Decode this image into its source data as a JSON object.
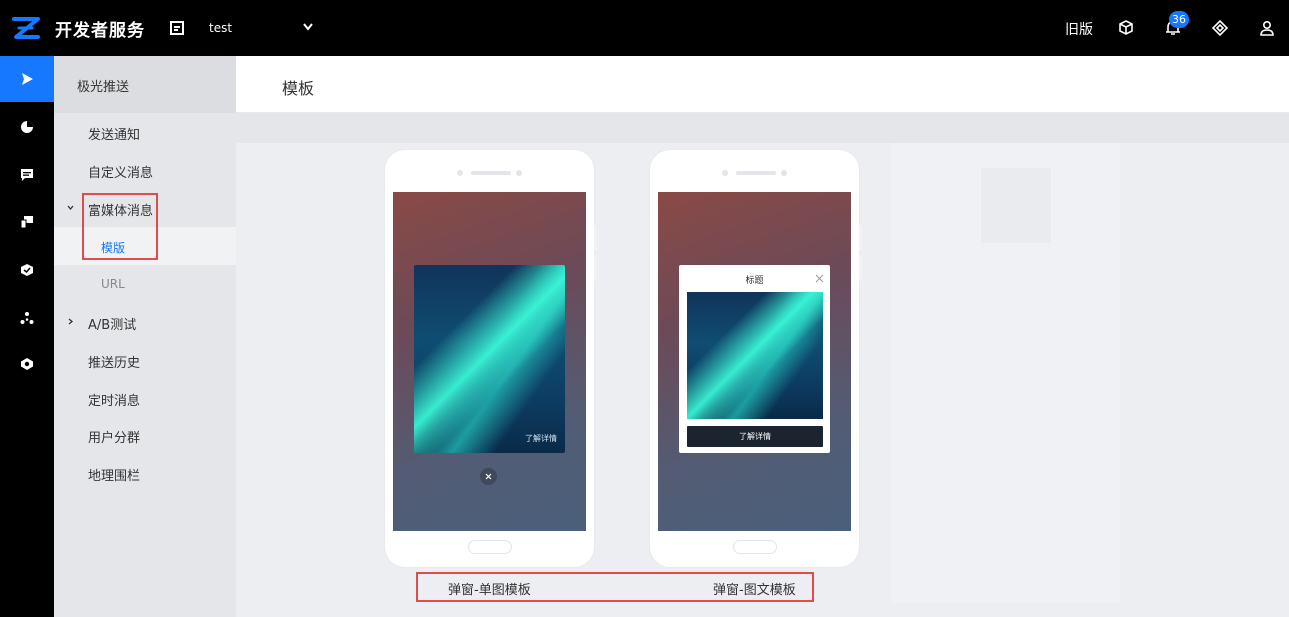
{
  "header": {
    "brand": "开发者服务",
    "app_name": "test",
    "old_version": "旧版",
    "notification_count": "36",
    "accent_color": "#1677ff"
  },
  "rail": {
    "items": [
      {
        "icon": "send-icon",
        "active": true
      },
      {
        "icon": "pie-chart-icon",
        "active": false
      },
      {
        "icon": "message-icon",
        "active": false
      },
      {
        "icon": "devices-icon",
        "active": false
      },
      {
        "icon": "shield-icon",
        "active": false
      },
      {
        "icon": "cluster-icon",
        "active": false
      },
      {
        "icon": "hexagon-icon",
        "active": false
      }
    ]
  },
  "sidebar": {
    "title": "极光推送",
    "items": [
      {
        "label": "发送通知"
      },
      {
        "label": "自定义消息"
      },
      {
        "label": "富媒体消息",
        "expanded": true,
        "children": [
          {
            "label": "模版",
            "active": true
          },
          {
            "label": "URL",
            "active": false
          }
        ]
      },
      {
        "label": "A/B测试",
        "expanded": false
      },
      {
        "label": "推送历史"
      },
      {
        "label": "定时消息"
      },
      {
        "label": "用户分群"
      },
      {
        "label": "地理围栏"
      }
    ]
  },
  "main": {
    "title": "模板",
    "templates": [
      {
        "caption": "弹窗-单图模板",
        "link_text": "了解详情"
      },
      {
        "caption": "弹窗-图文模板",
        "dialog_title": "标题",
        "button_text": "了解详情"
      }
    ]
  },
  "highlight_color": "#e24b4b"
}
